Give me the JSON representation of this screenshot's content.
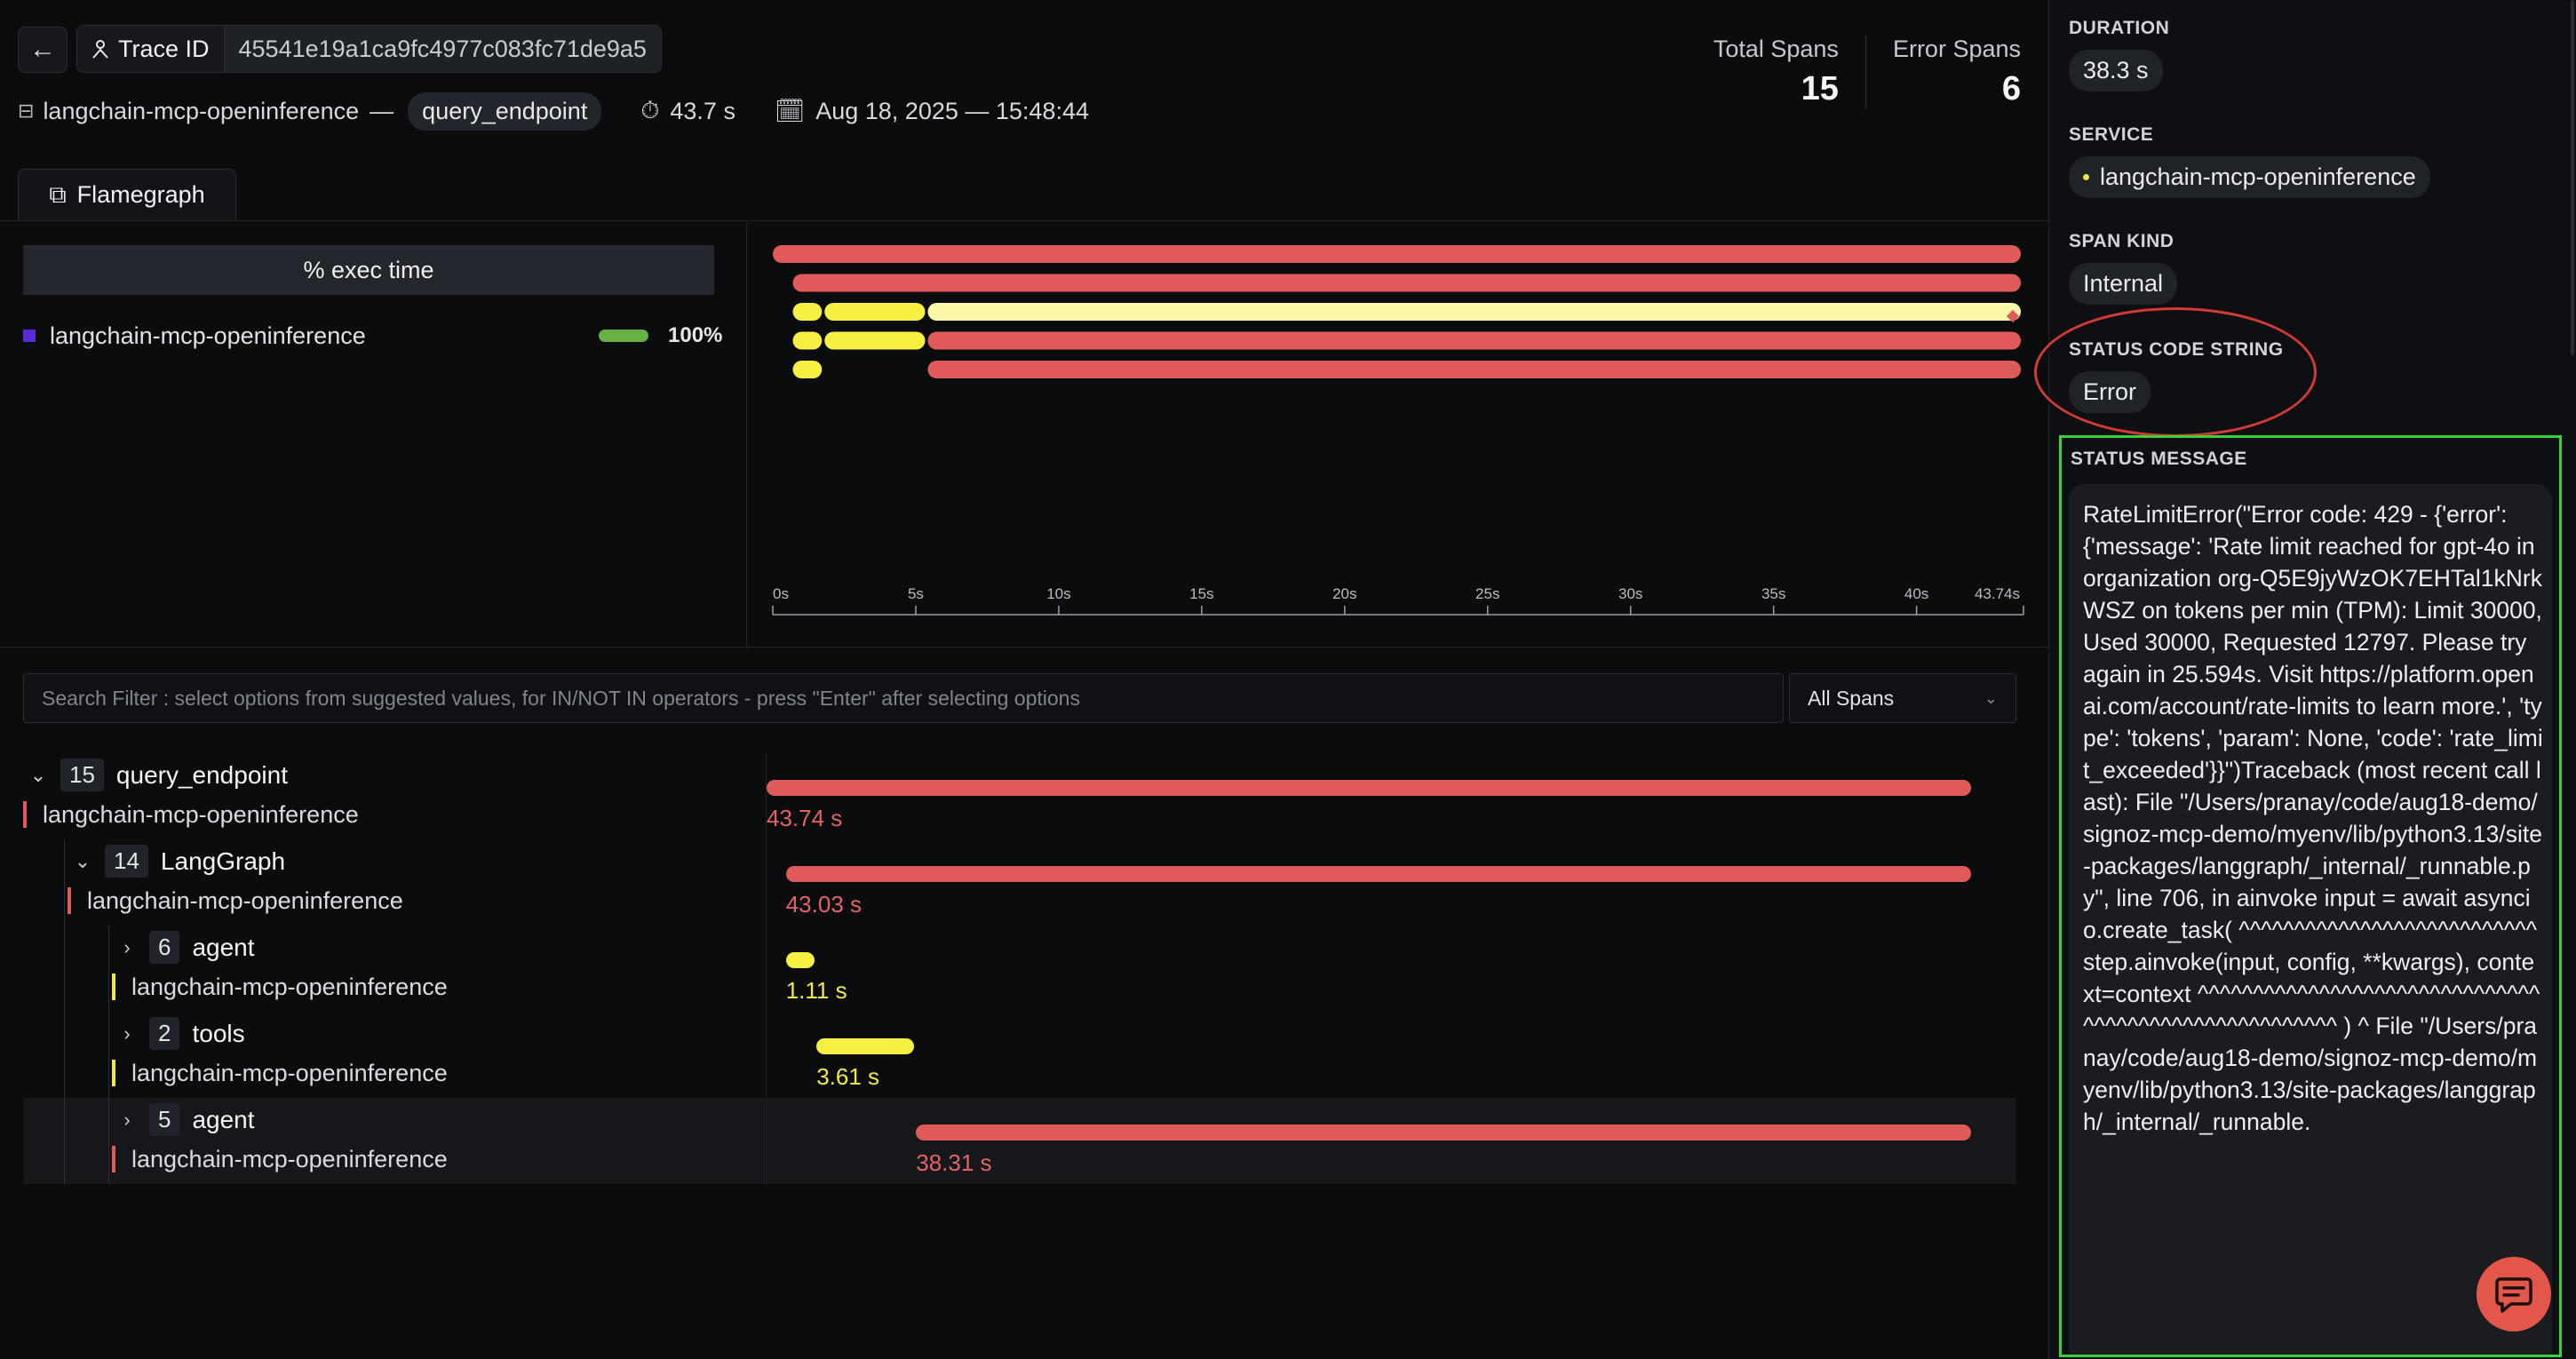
{
  "header": {
    "back_icon": "arrow-left-icon",
    "trace_id_label": "Trace ID",
    "trace_id_value": "45541e19a1ca9fc4977c083fc71de9a5",
    "service": "langchain-mcp-openinference",
    "separator": "—",
    "root_span": "query_endpoint",
    "duration": "43.7 s",
    "datetime": "Aug 18, 2025 — 15:48:44",
    "total_spans_label": "Total Spans",
    "total_spans": "15",
    "error_spans_label": "Error Spans",
    "error_spans": "6"
  },
  "tabs": [
    {
      "label": "Flamegraph",
      "icon": "flamegraph-icon"
    }
  ],
  "exec_time": {
    "header": "% exec time",
    "rows": [
      {
        "service": "langchain-mcp-openinference",
        "percent": "100%",
        "color": "#5a2ad6",
        "bar_color": "#66b044"
      }
    ]
  },
  "chart_data": {
    "type": "timeline",
    "x_ticks": [
      "0s",
      "5s",
      "10s",
      "15s",
      "20s",
      "25s",
      "30s",
      "35s",
      "40s",
      "43.74s"
    ],
    "x_max": 43.74,
    "rows": [
      [
        {
          "start": 0,
          "end": 43.74,
          "color": "#e05a5a"
        }
      ],
      [
        {
          "start": 0.7,
          "end": 43.74,
          "color": "#e05a5a"
        }
      ],
      [
        {
          "start": 0.7,
          "end": 1.81,
          "color": "#f6f043"
        },
        {
          "start": 1.81,
          "end": 5.42,
          "color": "#f6f043"
        },
        {
          "start": 5.42,
          "end": 43.74,
          "color": "#fbf7a6"
        }
      ],
      [
        {
          "start": 0.7,
          "end": 1.81,
          "color": "#f6f043"
        },
        {
          "start": 1.81,
          "end": 5.42,
          "color": "#f6f043"
        },
        {
          "start": 5.42,
          "end": 43.74,
          "color": "#e05a5a"
        }
      ],
      [
        {
          "start": 0.7,
          "end": 1.81,
          "color": "#f6f043"
        },
        {
          "start": 5.42,
          "end": 43.74,
          "color": "#e05a5a"
        }
      ]
    ]
  },
  "filter": {
    "placeholder": "Search Filter : select options from suggested values, for IN/NOT IN operators - press \"Enter\" after selecting options",
    "select_value": "All Spans"
  },
  "spans": [
    {
      "count": "15",
      "name": "query_endpoint",
      "service": "langchain-mcp-openinference",
      "duration": "43.74 s",
      "start": 0,
      "end": 43.74,
      "level": 0,
      "color": "red",
      "expanded": true
    },
    {
      "count": "14",
      "name": "LangGraph",
      "service": "langchain-mcp-openinference",
      "duration": "43.03 s",
      "start": 0.7,
      "end": 43.74,
      "level": 1,
      "color": "red",
      "expanded": true
    },
    {
      "count": "6",
      "name": "agent",
      "service": "langchain-mcp-openinference",
      "duration": "1.11 s",
      "start": 0.7,
      "end": 1.81,
      "level": 2,
      "color": "yellow",
      "expanded": false
    },
    {
      "count": "2",
      "name": "tools",
      "service": "langchain-mcp-openinference",
      "duration": "3.61 s",
      "start": 1.81,
      "end": 5.42,
      "level": 2,
      "color": "yellow",
      "expanded": false
    },
    {
      "count": "5",
      "name": "agent",
      "service": "langchain-mcp-openinference",
      "duration": "38.31 s",
      "start": 5.42,
      "end": 43.74,
      "level": 2,
      "color": "red",
      "expanded": false,
      "selected": true
    }
  ],
  "detail": {
    "duration_label": "DURATION",
    "duration": "38.3 s",
    "service_label": "SERVICE",
    "service": "langchain-mcp-openinference",
    "span_kind_label": "SPAN KIND",
    "span_kind": "Internal",
    "status_code_label": "STATUS CODE STRING",
    "status_code": "Error",
    "status_message_label": "STATUS MESSAGE",
    "status_message": "RateLimitError(\"Error code: 429 - {'error': {'message': 'Rate limit reached for gpt-4o in organization org-Q5E9jyWzOK7EHTal1kNrkWSZ on tokens per min (TPM): Limit 30000, Used 30000, Requested 12797. Please try again in 25.594s. Visit https://platform.openai.com/account/rate-limits to learn more.', 'type': 'tokens', 'param': None, 'code': 'rate_limit_exceeded'}}\")Traceback (most recent call last): File \"/Users/pranay/code/aug18-demo/signoz-mcp-demo/myenv/lib/python3.13/site-packages/langgraph/_internal/_runnable.py\", line 706, in ainvoke input = await asyncio.create_task( ^^^^^^^^^^^^^^^^^^^^^^^^^^^ step.ainvoke(input, config, **kwargs), context=context ^^^^^^^^^^^^^^^^^^^^^^^^^^^^^^^^^^^^^^^^^^^^^^^^^^^^^^ ) ^ File \"/Users/pranay/code/aug18-demo/signoz-mcp-demo/myenv/lib/python3.13/site-packages/langgraph/_internal/_runnable."
  }
}
